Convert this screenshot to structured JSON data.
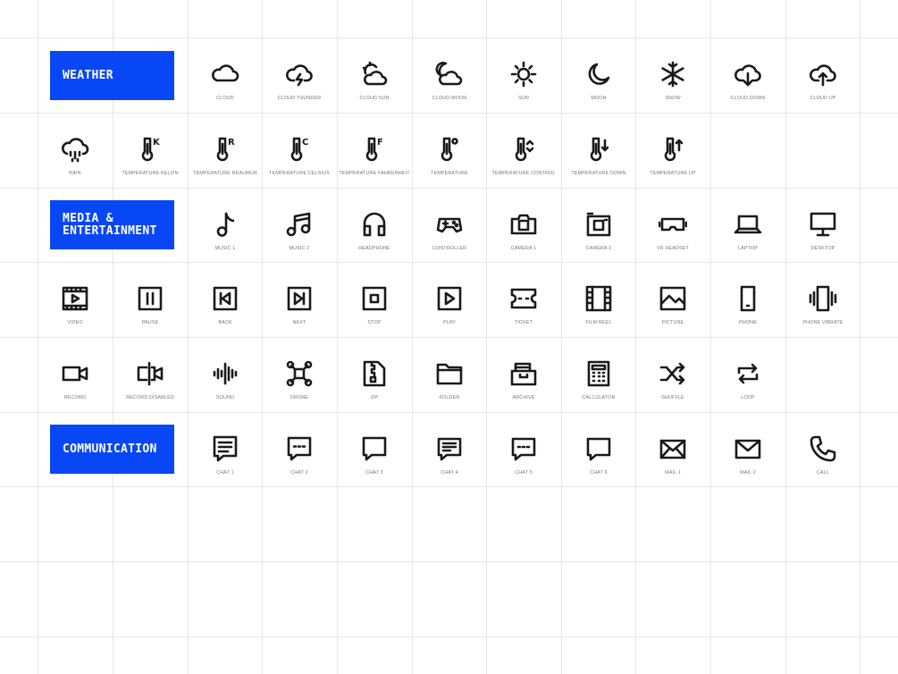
{
  "colors": {
    "accent": "#0847f5",
    "grid": "#e6e6e6",
    "icon": "#1a1a1a",
    "label": "#777777"
  },
  "sections": [
    {
      "title": "WEATHER"
    },
    {
      "title": "MEDIA &\nENTERTAINMENT"
    },
    {
      "title": "COMMUNICATION"
    }
  ],
  "icons": [
    {
      "name": "cloud-icon",
      "label": "CLOUD"
    },
    {
      "name": "cloud-thunder-icon",
      "label": "CLOUD THUNDER"
    },
    {
      "name": "cloud-sun-icon",
      "label": "CLOUD SUN"
    },
    {
      "name": "cloud-moon-icon",
      "label": "CLOUD MOON"
    },
    {
      "name": "sun-icon",
      "label": "SUN"
    },
    {
      "name": "moon-icon",
      "label": "MOON"
    },
    {
      "name": "snow-icon",
      "label": "SNOW"
    },
    {
      "name": "cloud-down-icon",
      "label": "CLOUD DOWN"
    },
    {
      "name": "cloud-up-icon",
      "label": "CLOUD UP"
    },
    {
      "name": "rain-icon",
      "label": "RAIN"
    },
    {
      "name": "temperature-kelvin-icon",
      "label": "TEMPERATURE KELVIN"
    },
    {
      "name": "temperature-reaumur-icon",
      "label": "TEMPERATURE RÉAUMUR"
    },
    {
      "name": "temperature-celsius-icon",
      "label": "TEMPERATURE CELSIUS"
    },
    {
      "name": "temperature-fahrenheit-icon",
      "label": "TEMPERATURE FAHRENHEIT"
    },
    {
      "name": "temperature-icon",
      "label": "TEMPERATURE"
    },
    {
      "name": "temperature-control-icon",
      "label": "TEMPERATURE CONTROL"
    },
    {
      "name": "temperature-down-icon",
      "label": "TEMPERATURE DOWN"
    },
    {
      "name": "temperature-up-icon",
      "label": "TEMPERATURE UP"
    },
    {
      "name": "music-1-icon",
      "label": "MUSIC 1"
    },
    {
      "name": "music-2-icon",
      "label": "MUSIC 2"
    },
    {
      "name": "headphone-icon",
      "label": "HEADPHONE"
    },
    {
      "name": "controller-icon",
      "label": "CONTROLLER"
    },
    {
      "name": "camera-1-icon",
      "label": "CAMERA 1"
    },
    {
      "name": "camera-2-icon",
      "label": "CAMERA 2"
    },
    {
      "name": "vr-headset-icon",
      "label": "VR HEADSET"
    },
    {
      "name": "laptop-icon",
      "label": "LAPTOP"
    },
    {
      "name": "desktop-icon",
      "label": "DESKTOP"
    },
    {
      "name": "video-icon",
      "label": "VIDEO"
    },
    {
      "name": "pause-icon",
      "label": "PAUSE"
    },
    {
      "name": "back-icon",
      "label": "BACK"
    },
    {
      "name": "next-icon",
      "label": "NEXT"
    },
    {
      "name": "stop-icon",
      "label": "STOP"
    },
    {
      "name": "play-icon",
      "label": "PLAY"
    },
    {
      "name": "ticket-icon",
      "label": "TICKET"
    },
    {
      "name": "film-reel-icon",
      "label": "FILM REEL"
    },
    {
      "name": "picture-icon",
      "label": "PICTURE"
    },
    {
      "name": "phone-icon",
      "label": "PHONE"
    },
    {
      "name": "phone-vibrate-icon",
      "label": "PHONE VIBRATE"
    },
    {
      "name": "record-icon",
      "label": "RECORD"
    },
    {
      "name": "record-disabled-icon",
      "label": "RECORD DISABLED"
    },
    {
      "name": "sound-icon",
      "label": "SOUND"
    },
    {
      "name": "drone-icon",
      "label": "DRONE"
    },
    {
      "name": "zip-icon",
      "label": "ZIP"
    },
    {
      "name": "folder-icon",
      "label": "FOLDER"
    },
    {
      "name": "archive-icon",
      "label": "ARCHIVE"
    },
    {
      "name": "calculator-icon",
      "label": "CALCULATOR"
    },
    {
      "name": "shuffle-icon",
      "label": "SHUFFLE"
    },
    {
      "name": "loop-icon",
      "label": "LOOP"
    },
    {
      "name": "chat-1-icon",
      "label": "CHAT 1"
    },
    {
      "name": "chat-2-icon",
      "label": "CHAT 2"
    },
    {
      "name": "chat-3-icon",
      "label": "CHAT 3"
    },
    {
      "name": "chat-4-icon",
      "label": "CHAT 4"
    },
    {
      "name": "chat-5-icon",
      "label": "CHAT 5"
    },
    {
      "name": "chat-6-icon",
      "label": "CHAT 6"
    },
    {
      "name": "mail-1-icon",
      "label": "MAIL 1"
    },
    {
      "name": "mail-2-icon",
      "label": "MAIL 2"
    },
    {
      "name": "call-icon",
      "label": "CALL"
    }
  ]
}
